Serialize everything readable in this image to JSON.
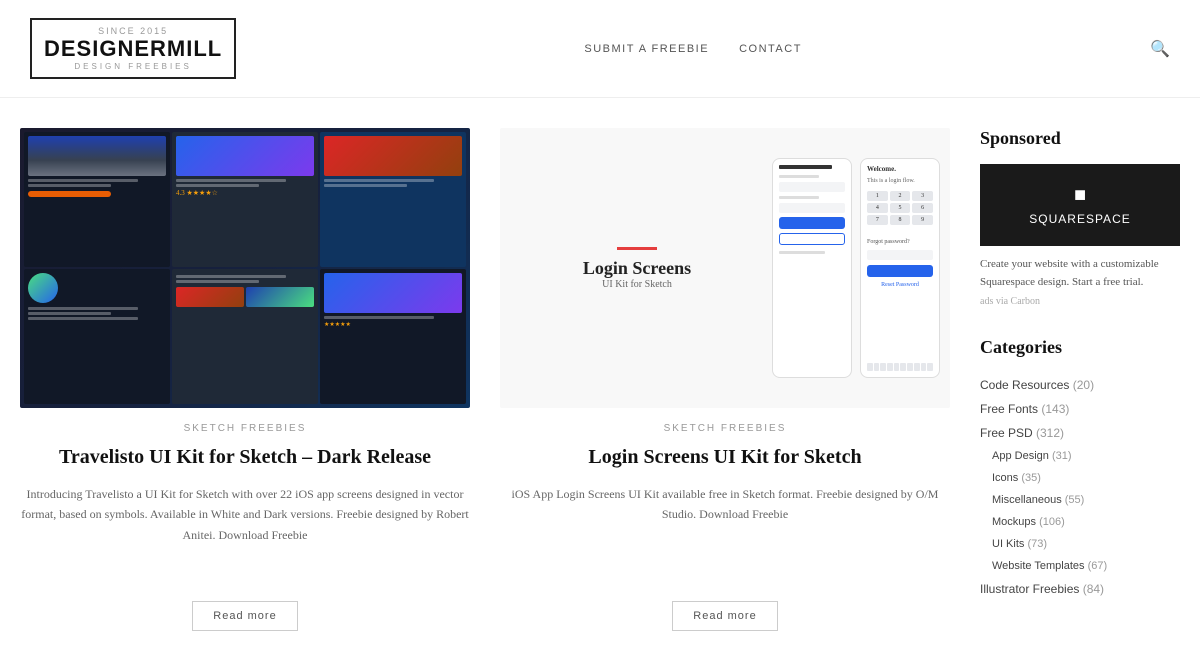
{
  "header": {
    "logo": {
      "since": "SINCE 2015",
      "name": "DESIGNERMILL",
      "sub": "DESIGN FREEBIES"
    },
    "nav": {
      "submit": "SUBMIT A FREEBIE",
      "contact": "CONTACT"
    }
  },
  "posts": [
    {
      "id": "post-1",
      "category": "SKETCH FREEBIES",
      "title": "Travelisto UI Kit for Sketch – Dark Release",
      "excerpt": "Introducing Travelisto a UI Kit for Sketch with over 22 iOS app screens designed in vector format, based on symbols. Available in White and Dark versions. Freebie designed by Robert Anitei. Download Freebie",
      "read_more": "Read more"
    },
    {
      "id": "post-2",
      "category": "SKETCH FREEBIES",
      "title": "Login Screens UI Kit for Sketch",
      "excerpt": "iOS App Login Screens UI Kit available free in Sketch format. Freebie designed by O/M Studio. Download Freebie",
      "read_more": "Read more"
    }
  ],
  "sidebar": {
    "sponsored": {
      "heading": "Sponsored",
      "brand": "SQUARESPACE",
      "description": "Create your website with a customizable Squarespace design. Start a free trial.",
      "ads_label": "ads via Carbon"
    },
    "categories": {
      "heading": "Categories",
      "items": [
        {
          "label": "Code Resources",
          "count": "(20)",
          "sub": false
        },
        {
          "label": "Free Fonts",
          "count": "(143)",
          "sub": false
        },
        {
          "label": "Free PSD",
          "count": "(312)",
          "sub": false
        },
        {
          "label": "App Design",
          "count": "(31)",
          "sub": true
        },
        {
          "label": "Icons",
          "count": "(35)",
          "sub": true
        },
        {
          "label": "Miscellaneous",
          "count": "(55)",
          "sub": true
        },
        {
          "label": "Mockups",
          "count": "(106)",
          "sub": true
        },
        {
          "label": "UI Kits",
          "count": "(73)",
          "sub": true
        },
        {
          "label": "Website Templates",
          "count": "(67)",
          "sub": true
        },
        {
          "label": "Illustrator Freebies",
          "count": "(84)",
          "sub": false
        }
      ]
    }
  }
}
